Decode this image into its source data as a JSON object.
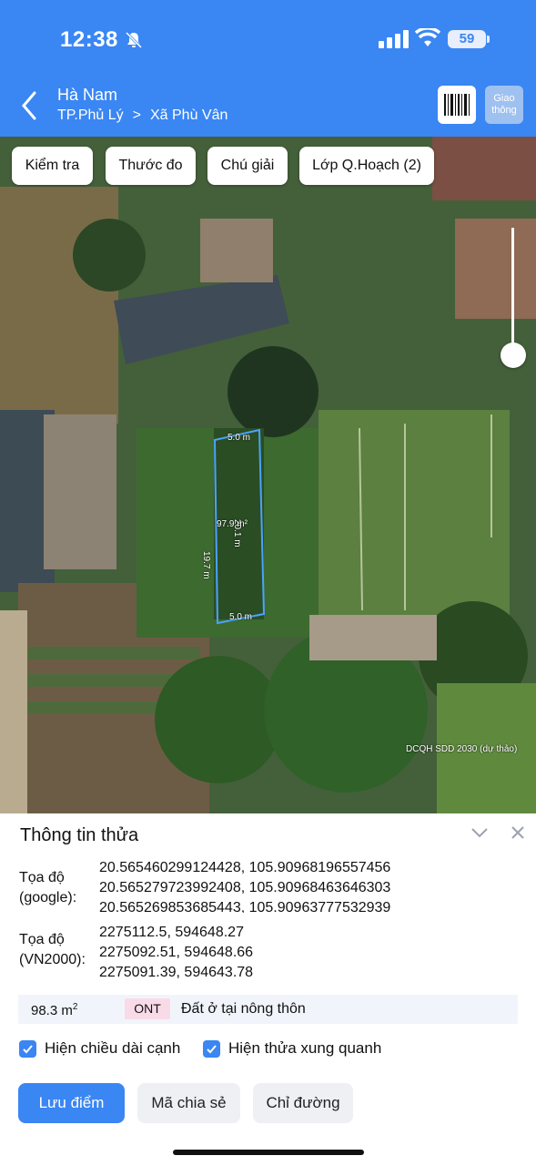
{
  "status_bar": {
    "time": "12:38",
    "battery": "59"
  },
  "header": {
    "province": "Hà Nam",
    "district": "TP.Phủ Lý",
    "commune": "Xã Phù Vân",
    "traffic_button": "Giao thông",
    "icons": {
      "back": "chevron-left-icon",
      "barcode": "barcode-icon"
    }
  },
  "map": {
    "buttons": [
      "Kiểm tra",
      "Thước đo",
      "Chú giải",
      "Lớp Q.Hoạch (2)"
    ],
    "watermark": "DCQH SDD 2030 (dự thảo)",
    "parcel": {
      "top_edge": "5.0 m",
      "bottom_edge": "5.0 m",
      "right_edge": "20.1 m",
      "left_edge": "19.7 m",
      "area": "97.9 m²"
    },
    "outline_color": "#4aa3ff"
  },
  "sheet": {
    "title": "Thông tin thửa",
    "google_label": "Tọa độ (google):",
    "google_coords": [
      "20.565460299124428, 105.90968196557456",
      "20.565279723992408, 105.90968463646303",
      "20.565269853685443, 105.90963777532939"
    ],
    "vn2000_label": "Tọa độ (VN2000):",
    "vn2000_coords": [
      "2275112.5, 594648.27",
      "2275092.51, 594648.66",
      "2275091.39, 594643.78"
    ],
    "area_value": "98.3 m",
    "area_unit_sup": "2",
    "land_code": "ONT",
    "land_type": "Đất ở tại nông thôn",
    "checkbox_edges": "Hiện chiều dài cạnh",
    "checkbox_surrounding": "Hiện thửa xung quanh",
    "btn_save": "Lưu điểm",
    "btn_share": "Mã chia sẻ",
    "btn_directions": "Chỉ đường"
  },
  "colors": {
    "primary": "#3a86f3",
    "badge": "#f9dbe7"
  }
}
